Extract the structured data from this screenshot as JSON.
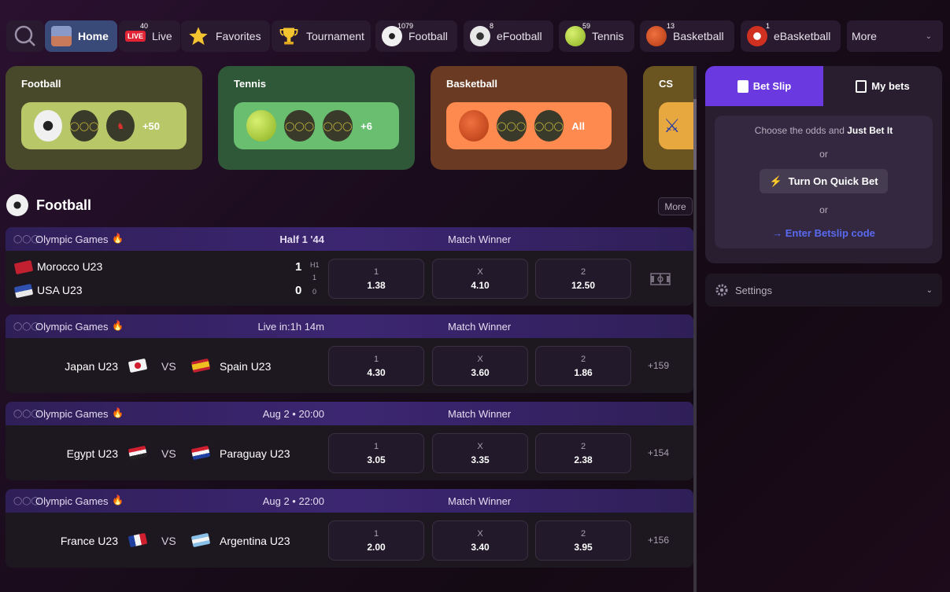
{
  "nav": {
    "items": [
      {
        "label": "Home"
      },
      {
        "label": "Live",
        "badge": "40",
        "tag": "LIVE"
      },
      {
        "label": "Favorites"
      },
      {
        "label": "Tournament"
      },
      {
        "label": "Football",
        "badge": "1079"
      },
      {
        "label": "eFootball",
        "badge": "8"
      },
      {
        "label": "Tennis",
        "badge": "59"
      },
      {
        "label": "Basketball",
        "badge": "13"
      },
      {
        "label": "eBasketball",
        "badge": "1"
      }
    ],
    "more_label": "More"
  },
  "categories": [
    {
      "title": "Football",
      "count": "+50",
      "card_color": "#4a4a20",
      "pill_color": "#b8c868"
    },
    {
      "title": "Tennis",
      "count": "+6",
      "card_color": "#2e5a38",
      "pill_color": "#6ac070"
    },
    {
      "title": "Basketball",
      "count": "All",
      "card_color": "#6a3a22",
      "pill_color": "#ff8a50"
    },
    {
      "title": "CS",
      "card_color": "#6a5420",
      "pill_color": "#e8a840"
    }
  ],
  "section": {
    "title": "Football",
    "more_label": "More"
  },
  "matches": [
    {
      "league": "Olympic Games",
      "status": "Half 1 '44",
      "market": "Match Winner",
      "home": "Morocco U23",
      "away": "USA U23",
      "home_score": "1",
      "away_score": "0",
      "period_label": "H1",
      "home_period": "1",
      "away_period": "0",
      "odds": [
        {
          "label": "1",
          "value": "1.38"
        },
        {
          "label": "X",
          "value": "4.10"
        },
        {
          "label": "2",
          "value": "12.50"
        }
      ]
    },
    {
      "league": "Olympic Games",
      "status": "Live in:1h 14m",
      "market": "Match Winner",
      "home": "Japan U23",
      "away": "Spain U23",
      "vs": "VS",
      "extra": "+159",
      "odds": [
        {
          "label": "1",
          "value": "4.30"
        },
        {
          "label": "X",
          "value": "3.60"
        },
        {
          "label": "2",
          "value": "1.86"
        }
      ]
    },
    {
      "league": "Olympic Games",
      "status": "Aug 2 • 20:00",
      "market": "Match Winner",
      "home": "Egypt U23",
      "away": "Paraguay U23",
      "vs": "VS",
      "extra": "+154",
      "odds": [
        {
          "label": "1",
          "value": "3.05"
        },
        {
          "label": "X",
          "value": "3.35"
        },
        {
          "label": "2",
          "value": "2.38"
        }
      ]
    },
    {
      "league": "Olympic Games",
      "status": "Aug 2 • 22:00",
      "market": "Match Winner",
      "home": "France U23",
      "away": "Argentina U23",
      "vs": "VS",
      "extra": "+156",
      "odds": [
        {
          "label": "1",
          "value": "2.00"
        },
        {
          "label": "X",
          "value": "3.40"
        },
        {
          "label": "2",
          "value": "3.95"
        }
      ]
    }
  ],
  "betslip": {
    "tab_betslip": "Bet Slip",
    "tab_mybets": "My bets",
    "choose_prefix": "Choose the odds and ",
    "choose_bold": "Just Bet It",
    "or1": "or",
    "quick_bet": "Turn On Quick Bet",
    "or2": "or",
    "betslip_code": "→ Enter Betslip code"
  },
  "settings": {
    "label": "Settings"
  },
  "colors": {
    "accent": "#6a3ae0",
    "link": "#5a6af0",
    "header_purple": "#3c2672"
  }
}
